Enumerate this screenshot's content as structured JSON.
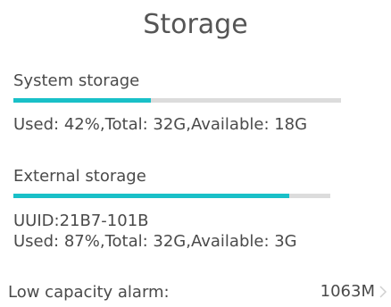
{
  "page": {
    "title": "Storage"
  },
  "system_storage": {
    "label": "System storage",
    "used_fraction": 0.42,
    "details": "Used: 42%,Total: 32G,Available: 18G"
  },
  "external_storage": {
    "label": "External storage",
    "used_fraction": 0.87,
    "uuid": "UUID:21B7-101B",
    "details": "Used: 87%,Total: 32G,Available: 3G"
  },
  "low_capacity_alarm": {
    "label": "Low capacity alarm:",
    "value": "1063M",
    "icon": "chevron-right-icon"
  },
  "colors": {
    "accent": "#19c0c8",
    "track": "#dcdcdc",
    "text": "#4a4a4a"
  }
}
